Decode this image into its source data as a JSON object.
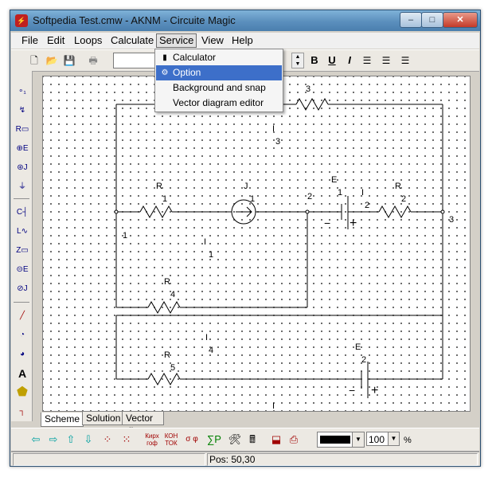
{
  "window": {
    "title": "Softpedia Test.cmw - AKNM - Circuite Magic",
    "app_icon": "circuit-magic-icon"
  },
  "titlebar_buttons": {
    "minimize": "‒",
    "maximize": "□",
    "close": "✕"
  },
  "menu": {
    "file": "File",
    "edit": "Edit",
    "loops": "Loops",
    "calculate": "Calculate",
    "service": "Service",
    "view": "View",
    "help": "Help"
  },
  "service_menu": {
    "items": [
      {
        "label": "Calculator",
        "icon": "calculator-icon"
      },
      {
        "label": "Option",
        "icon": "option-icon"
      },
      {
        "label": "Background and snap",
        "icon": ""
      },
      {
        "label": "Vector diagram editor",
        "icon": ""
      }
    ],
    "selected": "Option"
  },
  "format_toolbar": {
    "bold": "B",
    "underline": "U",
    "italic": "I"
  },
  "schematic": {
    "top_resistor_subscript": "3",
    "current_i3": "I",
    "current_i3_sub": "3",
    "r1": "R",
    "r1_sub": "1",
    "j1": "J",
    "j1_sub": "1",
    "node_2": "2",
    "e1": "E",
    "e1_sub": "1",
    "i2": "I",
    "i2_sub": "2",
    "r2": "R",
    "r2_sub": "2",
    "node_3": "3",
    "node_1": "1",
    "i1": "I",
    "i1_sub": "1",
    "r4": "R",
    "r4_sub": "4",
    "i4": "I",
    "i4_sub": "4",
    "r5": "R",
    "r5_sub": "5",
    "e2": "E",
    "e2_sub": "2",
    "bottom_current": "I",
    "minus": "−",
    "plus": "+",
    "line_color": "#000000"
  },
  "tabs": [
    {
      "label": "Scheme",
      "active": true
    },
    {
      "label": "Solution",
      "active": false
    },
    {
      "label": "Vector diagram",
      "active": false
    }
  ],
  "bottom_toolbar": {
    "kirchhoff_label_top": "Кирх",
    "kirchhoff_label_bottom": "гоф",
    "loop_label_top": "КОН",
    "loop_label_bottom": "ТОК",
    "phi_label": "σ φ",
    "color_value": "#000000",
    "zoom_value": "100",
    "percent": "%"
  },
  "status": {
    "position": "Pos: 50,30"
  }
}
